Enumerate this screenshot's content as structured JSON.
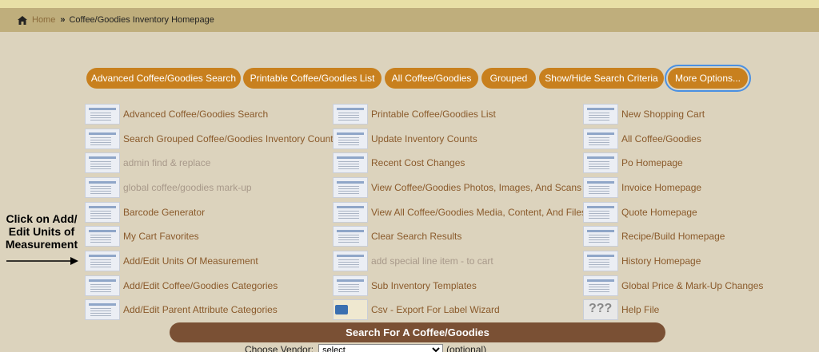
{
  "breadcrumb": {
    "home": "Home",
    "separator": "»",
    "current": "Coffee/Goodies Inventory Homepage"
  },
  "buttons": [
    "Advanced Coffee/Goodies Search",
    "Printable Coffee/Goodies List",
    "All Coffee/Goodies",
    "Grouped",
    "Show/Hide Search Criteria",
    "More Options..."
  ],
  "column1": [
    {
      "label": "Advanced Coffee/Goodies Search",
      "disabled": false
    },
    {
      "label": "Search Grouped Coffee/Goodies Inventory Counts",
      "disabled": false
    },
    {
      "label": "admin find & replace",
      "disabled": true
    },
    {
      "label": "global coffee/goodies mark-up",
      "disabled": true
    },
    {
      "label": "Barcode Generator",
      "disabled": false
    },
    {
      "label": "My Cart Favorites",
      "disabled": false
    },
    {
      "label": "Add/Edit Units Of Measurement",
      "disabled": false
    },
    {
      "label": "Add/Edit Coffee/Goodies Categories",
      "disabled": false
    },
    {
      "label": "Add/Edit Parent Attribute Categories",
      "disabled": false
    }
  ],
  "column2": [
    {
      "label": "Printable Coffee/Goodies List",
      "disabled": false
    },
    {
      "label": "Update Inventory Counts",
      "disabled": false
    },
    {
      "label": "Recent Cost Changes",
      "disabled": false
    },
    {
      "label": "View Coffee/Goodies Photos, Images, And Scans",
      "disabled": false
    },
    {
      "label": "View All Coffee/Goodies Media, Content, And Files",
      "disabled": false
    },
    {
      "label": "Clear Search Results",
      "disabled": false
    },
    {
      "label": "add special line item - to cart",
      "disabled": true
    },
    {
      "label": "Sub Inventory Templates",
      "disabled": false
    },
    {
      "label": "Csv - Export For Label Wizard",
      "disabled": false
    }
  ],
  "column3": [
    {
      "label": "New Shopping Cart",
      "disabled": false
    },
    {
      "label": "All Coffee/Goodies",
      "disabled": false
    },
    {
      "label": "Po Homepage",
      "disabled": false
    },
    {
      "label": "Invoice Homepage",
      "disabled": false
    },
    {
      "label": "Quote Homepage",
      "disabled": false
    },
    {
      "label": "Recipe/Build Homepage",
      "disabled": false
    },
    {
      "label": "History Homepage",
      "disabled": false
    },
    {
      "label": "Global Price & Mark-Up Changes",
      "disabled": false
    },
    {
      "label": "Help File",
      "disabled": false
    }
  ],
  "annotation": {
    "line1": "Click on Add/",
    "line2": "Edit Units of",
    "line3": "Measurement"
  },
  "search": {
    "title": "Search For A Coffee/Goodies",
    "vendor_label": "Choose Vendor:",
    "vendor_selected": "select",
    "optional": "(optional)"
  },
  "icons": {
    "home": "home-icon",
    "thumbnail": "page-thumbnail-icon",
    "arrow": "arrow-right-icon"
  }
}
